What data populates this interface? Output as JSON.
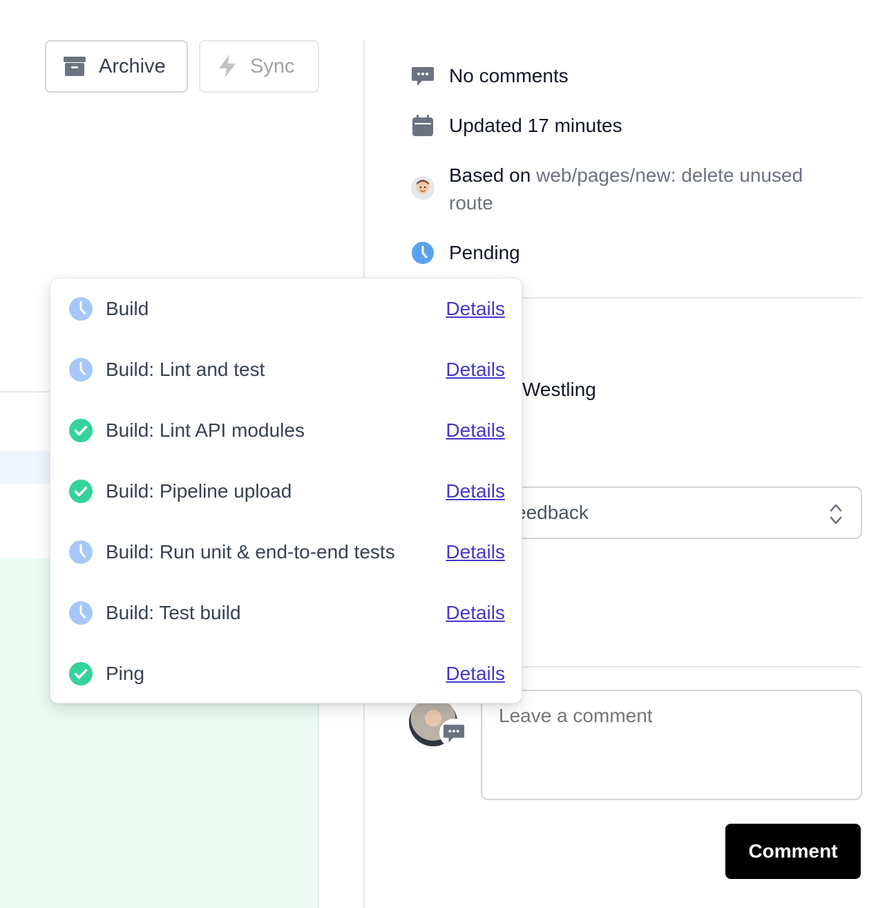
{
  "toolbar": {
    "archive_label": "Archive",
    "sync_label": "Sync"
  },
  "meta": {
    "comments": "No comments",
    "updated": "Updated 17 minutes",
    "based_on_prefix": "Based on",
    "based_on_link": "web/pages/new: delete unused route",
    "status": "Pending"
  },
  "reviewer_name_fragment": "Westling",
  "review_select": {
    "value_fragment": "eedback"
  },
  "comment": {
    "placeholder": "Leave a comment",
    "submit_label": "Comment"
  },
  "checks": {
    "details_label": "Details",
    "items": [
      {
        "label": "Build",
        "status": "pending"
      },
      {
        "label": "Build: Lint and test",
        "status": "pending"
      },
      {
        "label": "Build: Lint API modules",
        "status": "success"
      },
      {
        "label": "Build: Pipeline upload",
        "status": "success"
      },
      {
        "label": "Build: Run unit & end-to-end tests",
        "status": "pending"
      },
      {
        "label": "Build: Test build",
        "status": "pending"
      },
      {
        "label": "Ping",
        "status": "success"
      }
    ]
  },
  "colors": {
    "pending_icon": "#a5c8f7",
    "pending_icon_strong": "#5aa2f0",
    "success_icon": "#34d399",
    "link": "#4338ca",
    "comment_button_bg": "#000000",
    "left_highlight_green": "#ebfbf3",
    "left_highlight_blue": "#f0f6ff"
  }
}
